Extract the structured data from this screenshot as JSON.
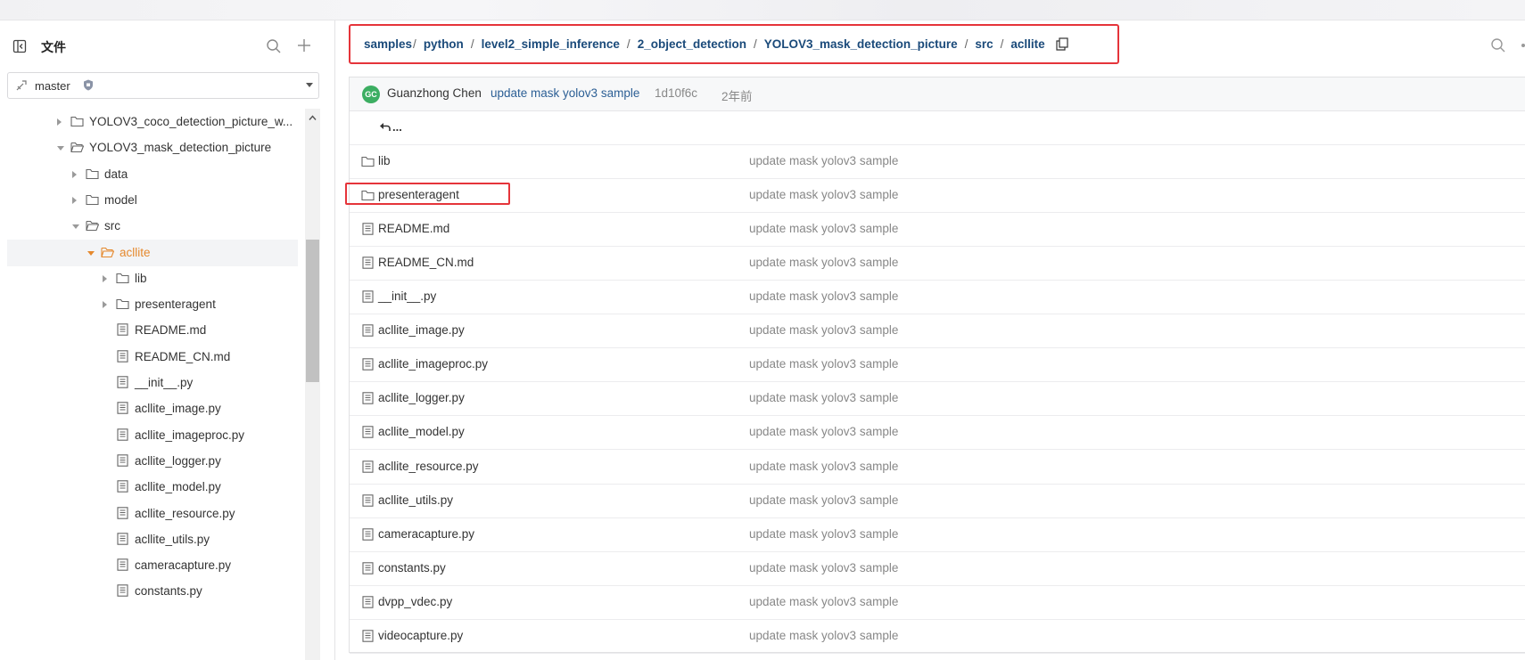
{
  "sidebar": {
    "title": "文件",
    "branch": "master",
    "tree": [
      {
        "label": "YOLOV3_coco_detection_picture_w...",
        "type": "folder",
        "depth": 0,
        "state": "collapsed"
      },
      {
        "label": "YOLOV3_mask_detection_picture",
        "type": "folder",
        "depth": 0,
        "state": "expanded"
      },
      {
        "label": "data",
        "type": "folder",
        "depth": 1,
        "state": "collapsed"
      },
      {
        "label": "model",
        "type": "folder",
        "depth": 1,
        "state": "collapsed"
      },
      {
        "label": "src",
        "type": "folder",
        "depth": 1,
        "state": "expanded"
      },
      {
        "label": "acllite",
        "type": "folder",
        "depth": 2,
        "state": "expanded",
        "active": true
      },
      {
        "label": "lib",
        "type": "folder",
        "depth": 3,
        "state": "collapsed"
      },
      {
        "label": "presenteragent",
        "type": "folder",
        "depth": 3,
        "state": "collapsed"
      },
      {
        "label": "README.md",
        "type": "file",
        "depth": 3
      },
      {
        "label": "README_CN.md",
        "type": "file",
        "depth": 3
      },
      {
        "label": "__init__.py",
        "type": "file",
        "depth": 3
      },
      {
        "label": "acllite_image.py",
        "type": "file",
        "depth": 3
      },
      {
        "label": "acllite_imageproc.py",
        "type": "file",
        "depth": 3
      },
      {
        "label": "acllite_logger.py",
        "type": "file",
        "depth": 3
      },
      {
        "label": "acllite_model.py",
        "type": "file",
        "depth": 3
      },
      {
        "label": "acllite_resource.py",
        "type": "file",
        "depth": 3
      },
      {
        "label": "acllite_utils.py",
        "type": "file",
        "depth": 3
      },
      {
        "label": "cameracapture.py",
        "type": "file",
        "depth": 3
      },
      {
        "label": "constants.py",
        "type": "file",
        "depth": 3
      }
    ]
  },
  "breadcrumb": [
    "samples",
    "python",
    "level2_simple_inference",
    "2_object_detection",
    "YOLOV3_mask_detection_picture",
    "src",
    "acllite"
  ],
  "commit": {
    "avatar_initials": "GC",
    "author": "Guanzhong Chen",
    "message": "update mask yolov3 sample",
    "hash": "1d10f6c",
    "time": "2年前"
  },
  "back_label": "...",
  "files": [
    {
      "name": "lib",
      "type": "folder",
      "message": "update mask yolov3 sample"
    },
    {
      "name": "presenteragent",
      "type": "folder",
      "message": "update mask yolov3 sample"
    },
    {
      "name": "README.md",
      "type": "file",
      "message": "update mask yolov3 sample"
    },
    {
      "name": "README_CN.md",
      "type": "file",
      "message": "update mask yolov3 sample"
    },
    {
      "name": "__init__.py",
      "type": "file",
      "message": "update mask yolov3 sample"
    },
    {
      "name": "acllite_image.py",
      "type": "file",
      "message": "update mask yolov3 sample"
    },
    {
      "name": "acllite_imageproc.py",
      "type": "file",
      "message": "update mask yolov3 sample"
    },
    {
      "name": "acllite_logger.py",
      "type": "file",
      "message": "update mask yolov3 sample"
    },
    {
      "name": "acllite_model.py",
      "type": "file",
      "message": "update mask yolov3 sample"
    },
    {
      "name": "acllite_resource.py",
      "type": "file",
      "message": "update mask yolov3 sample"
    },
    {
      "name": "acllite_utils.py",
      "type": "file",
      "message": "update mask yolov3 sample"
    },
    {
      "name": "cameracapture.py",
      "type": "file",
      "message": "update mask yolov3 sample"
    },
    {
      "name": "constants.py",
      "type": "file",
      "message": "update mask yolov3 sample"
    },
    {
      "name": "dvpp_vdec.py",
      "type": "file",
      "message": "update mask yolov3 sample"
    },
    {
      "name": "videocapture.py",
      "type": "file",
      "message": "update mask yolov3 sample"
    }
  ],
  "colors": {
    "link": "#1a4a7a",
    "active": "#e5892e",
    "annotation": "#e5343a",
    "avatar": "#3cae62"
  },
  "icons": {
    "collapse": "sidebar-collapse-icon",
    "search": "search-icon",
    "add": "plus-icon",
    "branch": "branch-icon",
    "protected": "shield-icon",
    "folder": "folder-icon",
    "file": "file-icon",
    "copy": "copy-icon",
    "back": "return-arrow-icon"
  }
}
